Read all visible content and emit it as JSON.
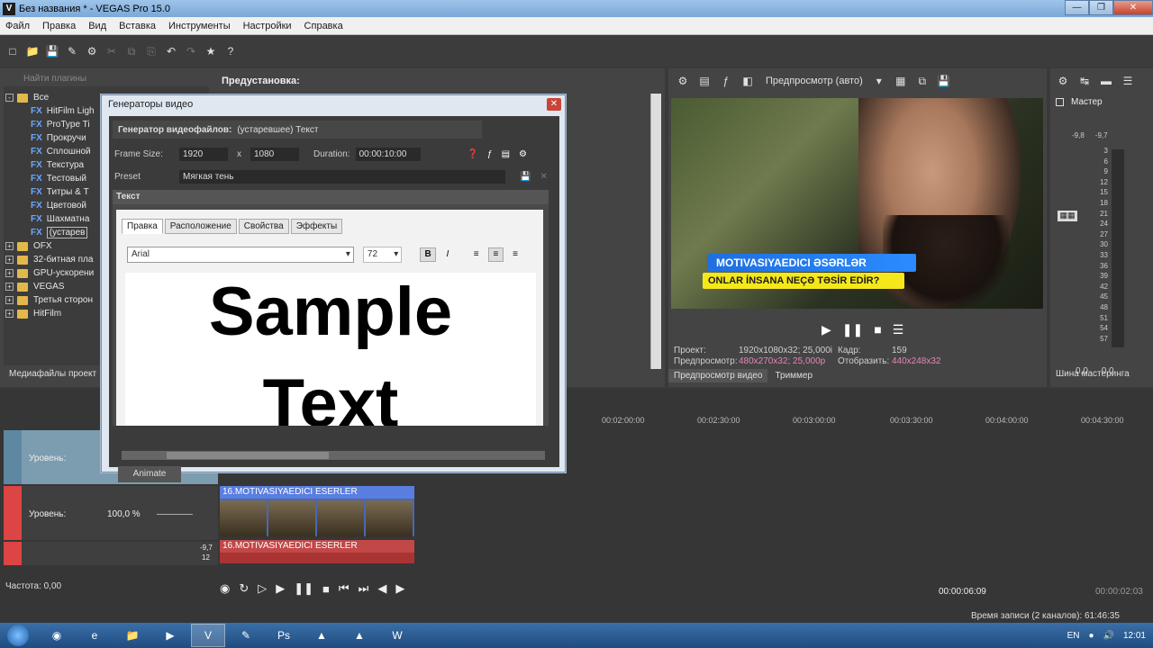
{
  "window": {
    "title": "Без названия * - VEGAS Pro 15.0",
    "app_icon": "V"
  },
  "menu": [
    "Файл",
    "Правка",
    "Вид",
    "Вставка",
    "Инструменты",
    "Настройки",
    "Справка"
  ],
  "plugins": {
    "search_placeholder": "Найти плагины",
    "preset_label": "Предустановка:",
    "root": "Все",
    "fx_items": [
      "HitFilm Ligh",
      "ProType Ti",
      "Прокручи",
      "Сплошной",
      "Текстура",
      "Тестовый",
      "Титры & T",
      "Цветовой",
      "Шахматна",
      "(устарев"
    ],
    "folders": [
      "OFX",
      "32-битная пла",
      "GPU-ускорени",
      "VEGAS",
      "Третья сторон",
      "HitFilm"
    ],
    "bottom_tab": "Медиафайлы проект"
  },
  "dialog": {
    "title": "Генераторы видео",
    "generator_label": "Генератор видеофайлов:",
    "generator_value": "(устаревшее) Текст",
    "frame_size_label": "Frame Size:",
    "width": "1920",
    "x": "x",
    "height": "1080",
    "duration_label": "Duration:",
    "duration": "00:00:10:00",
    "preset_label": "Preset",
    "preset_value": "Мягкая тень",
    "section_title": "Текст",
    "tabs": [
      "Правка",
      "Расположение",
      "Свойства",
      "Эффекты"
    ],
    "font": "Arial",
    "font_size": "72",
    "bold": "B",
    "italic": "I",
    "sample_line1": "Sample",
    "sample_line2": "Text",
    "animate": "Animate"
  },
  "preview": {
    "mode": "Предпросмотр (авто)",
    "caption_line1": "MOTIVASIYAEDICI ƏSƏRLƏR",
    "caption_line2": "ONLAR İNSANA NEÇƏ TƏSİR EDİR?",
    "project_label": "Проект:",
    "project_value": "1920x1080x32; 25,000i",
    "preview_label": "Предпросмотр:",
    "preview_value": "480x270x32; 25,000p",
    "frame_label": "Кадр:",
    "frame_value": "159",
    "display_label": "Отобразить:",
    "display_value": "440x248x32",
    "tab_preview": "Предпросмотр видео",
    "tab_trimmer": "Триммер"
  },
  "master": {
    "title": "Мастер",
    "top_values": [
      "-9,8",
      "-9,7"
    ],
    "scale": [
      "3",
      "6",
      "9",
      "12",
      "15",
      "18",
      "21",
      "24",
      "27",
      "30",
      "33",
      "36",
      "39",
      "42",
      "45",
      "48",
      "51",
      "54",
      "57"
    ],
    "bottom_values": [
      "0,0",
      "0,0"
    ],
    "bus_tab": "Шина мастеринга"
  },
  "timeline": {
    "ruler": [
      "00:02:00:00",
      "00:02:30:00",
      "00:03:00:00",
      "00:03:30:00",
      "00:04:00:00",
      "00:04:30:00"
    ],
    "track1_label": "Уровень:",
    "track2_label": "Уровень:",
    "track2_level": "100,0 %",
    "track3_values": [
      "-9,7",
      "12"
    ],
    "clip_video": "16.MOTIVASIYAEDICI ESERLER",
    "clip_audio": "16.MOTIVASIYAEDICI ESERLER",
    "frequency": "Частота: 0,00",
    "time_cursor": "00:00:06:09",
    "time_end": "00:00:02:03",
    "record_time": "Время записи (2 каналов): 61:46:35"
  },
  "taskbar": {
    "lang": "EN",
    "clock": "12:01"
  }
}
